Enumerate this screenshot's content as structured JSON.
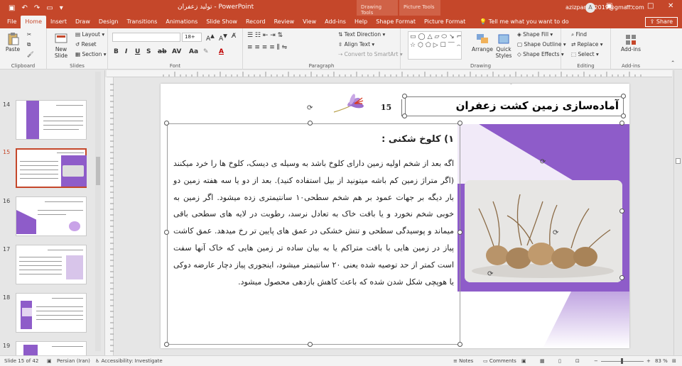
{
  "titlebar": {
    "doc_title": "تولید زعفران",
    "separator": "-",
    "app_name": "PowerPoint",
    "context_tabs": [
      "Drawing Tools",
      "Picture Tools"
    ],
    "user_email": "azizpanah2019@gmail.com",
    "avatar_letter": "A"
  },
  "tabs": [
    "File",
    "Home",
    "Insert",
    "Draw",
    "Design",
    "Transitions",
    "Animations",
    "Slide Show",
    "Record",
    "Review",
    "View",
    "Add-ins",
    "Help",
    "Shape Format",
    "Picture Format"
  ],
  "active_tab": "Home",
  "tell_me": "Tell me what you want to do",
  "share_label": "Share",
  "ribbon": {
    "clipboard": {
      "label": "Clipboard",
      "paste": "Paste"
    },
    "slides": {
      "label": "Slides",
      "new_slide": "New Slide",
      "layout": "Layout",
      "reset": "Reset",
      "section": "Section"
    },
    "font": {
      "label": "Font",
      "font_name": "",
      "font_size": "18+"
    },
    "paragraph": {
      "label": "Paragraph",
      "text_direction": "Text Direction",
      "align_text": "Align Text",
      "convert": "Convert to SmartArt"
    },
    "drawing": {
      "label": "Drawing",
      "arrange": "Arrange",
      "quick_styles": "Quick Styles",
      "shape_fill": "Shape Fill",
      "shape_outline": "Shape Outline",
      "shape_effects": "Shape Effects"
    },
    "editing": {
      "label": "Editing",
      "find": "Find",
      "replace": "Replace",
      "select": "Select"
    },
    "addins": {
      "label": "Add-ins",
      "button": "Add-ins"
    }
  },
  "thumbnails": [
    {
      "num": "14"
    },
    {
      "num": "15",
      "active": true
    },
    {
      "num": "16"
    },
    {
      "num": "17"
    },
    {
      "num": "18"
    },
    {
      "num": "19"
    }
  ],
  "slide": {
    "title": "آماده‌سازی زمین کشت زعفران",
    "number": "15",
    "heading": "۱) کلوخ شکنی :",
    "body": "اگه بعد از شخم اولیه زمین دارای کلوخ باشد به وسیله ی دیسک، کلوخ ها را خرد میکنند (اگر متراژ زمین کم باشه میتونید از بیل استفاده کنید). بعد از دو یا سه هفته زمین دو بار دیگه بر جهات عمود بر هم شخم سطحی۱۰ سانتیمتری زده میشود. اگر زمین به خوبی شخم نخورد و یا بافت خاک به تعادل نرسد، رطوبت در لایه های سطحی باقی میماند و پوسیدگی سطحی و تنش خشکی در عمق های پایین تر رخ میدهد. عمق کاشت پیاز در زمین هایی با بافت متراکم یا به بیان ساده تر زمین هایی که خاک آنها سفت است کمتر از حد توصیه شده یعنی ۲۰ سانتیمتر میشود، اینجوری پیاز دچار عارضه دوکی یا هوپچی شکل شدن شده که باعث کاهش بازدهی محصول میشود."
  },
  "status": {
    "slide_of": "Slide 15 of 42",
    "language": "Persian (Iran)",
    "accessibility": "Accessibility: Investigate",
    "notes": "Notes",
    "comments": "Comments",
    "zoom": "83 %"
  },
  "colors": {
    "accent": "#c5472a",
    "purple": "#8e5cc9"
  }
}
